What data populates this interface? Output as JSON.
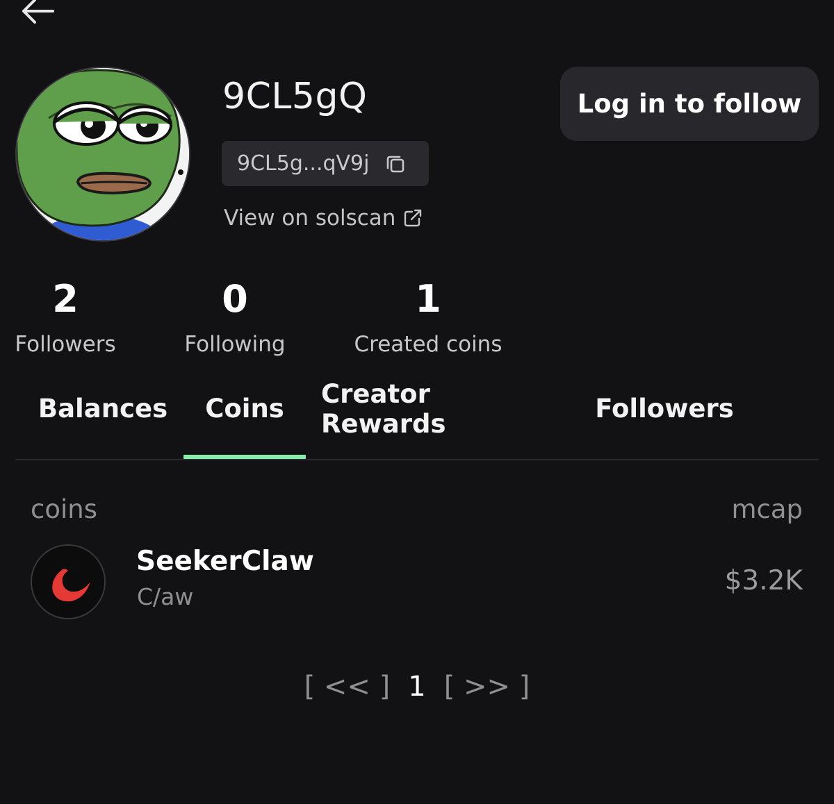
{
  "profile": {
    "username": "9CL5gQ",
    "address_short": "9CL5g...qV9j",
    "solscan_link": "View on solscan",
    "follow_button": "Log in to follow"
  },
  "stats": [
    {
      "value": "2",
      "label": "Followers"
    },
    {
      "value": "0",
      "label": "Following"
    },
    {
      "value": "1",
      "label": "Created coins"
    }
  ],
  "tabs": [
    {
      "label": "Balances"
    },
    {
      "label": "Coins",
      "active": true
    },
    {
      "label": "Creator Rewards"
    },
    {
      "label": "Followers"
    }
  ],
  "coins_table": {
    "headers": {
      "coins": "coins",
      "mcap": "mcap"
    },
    "rows": [
      {
        "name": "SeekerClaw",
        "ticker": "C/aw",
        "mcap": "$3.2K"
      }
    ]
  },
  "pagination": {
    "prev": "[ << ]",
    "current": "1",
    "next": "[ >> ]"
  },
  "colors": {
    "background": "#121214",
    "tab_active_underline": "#86efac",
    "button_bg": "#28282c"
  }
}
